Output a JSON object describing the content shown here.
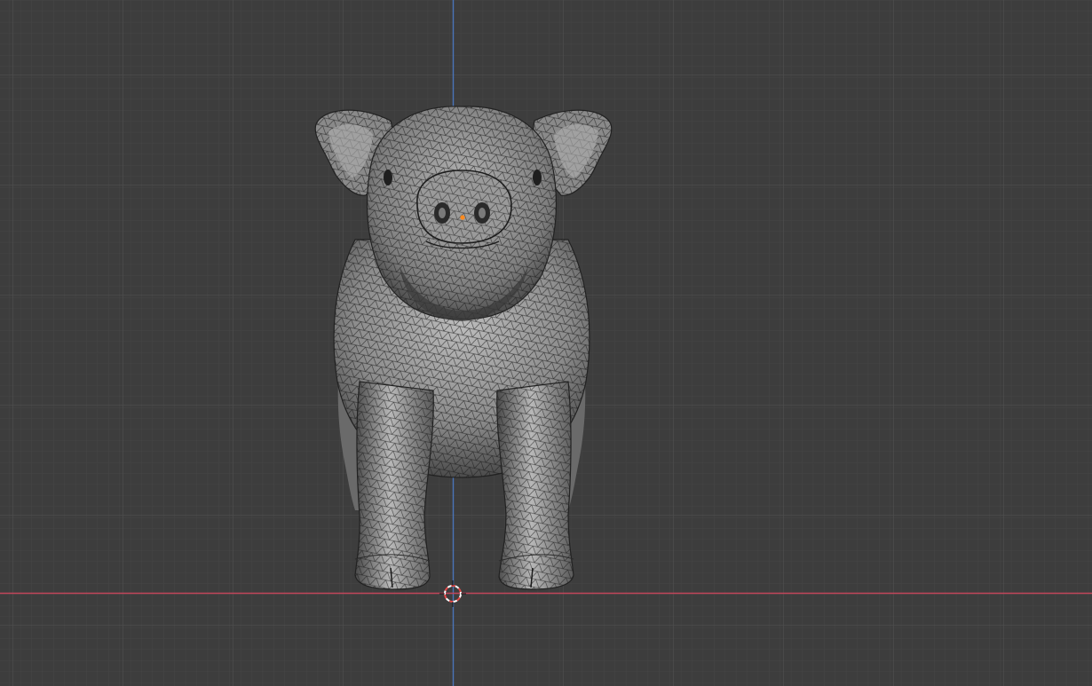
{
  "viewport": {
    "view": "front-orthographic",
    "shading": "wireframe-on-solid",
    "object": "pig-mesh",
    "colors": {
      "background": "#3d3d3d",
      "grid_minor": "#454545",
      "grid_major": "#4f4f4f",
      "x_axis": "#c2455a",
      "z_axis": "#4a74b8",
      "mesh_fill": "#8e8e8e",
      "mesh_wire": "#1a1a1a",
      "origin_dot": "#ff8a1f",
      "cursor_red": "#e84a4a",
      "cursor_white": "#ffffff"
    },
    "icons": {
      "cursor": "3d-cursor-icon",
      "origin": "object-origin-icon"
    }
  }
}
